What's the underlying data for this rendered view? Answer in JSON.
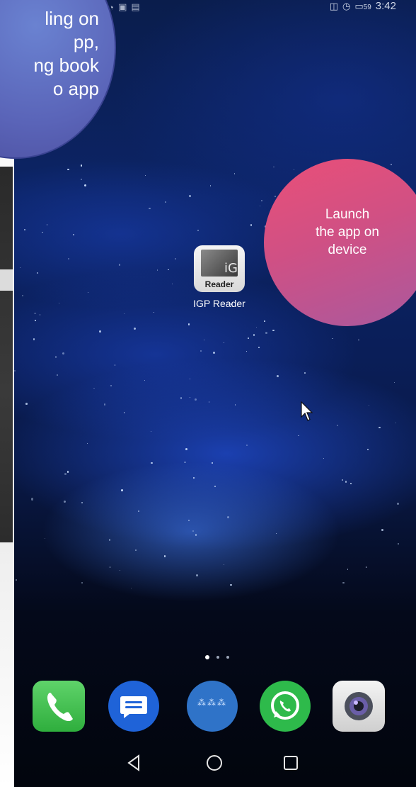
{
  "status_bar": {
    "time": "3:42",
    "battery": "59"
  },
  "callout_left": {
    "lines": [
      "ling on",
      "pp,",
      "ng book",
      "o app"
    ]
  },
  "callout_right": {
    "lines": [
      "Launch",
      "the app on",
      "device"
    ]
  },
  "home_screen": {
    "app": {
      "icon_text_top": "iG",
      "icon_text_bottom": "Reader",
      "label": "IGP Reader"
    },
    "page_indicator": {
      "total_pages": 3,
      "active_page": 1
    },
    "dock": [
      "phone",
      "messages",
      "folder",
      "whatsapp",
      "camera"
    ]
  },
  "nav_bar": [
    "back",
    "home",
    "recents"
  ],
  "colors": {
    "callout_left": "#5a64b8",
    "callout_right_start": "#ea4f78",
    "callout_right_end": "#a9599e",
    "dock_phone": "#2fae3d",
    "dock_messages": "#1f63d8",
    "dock_whatsapp": "#2eba4b"
  }
}
